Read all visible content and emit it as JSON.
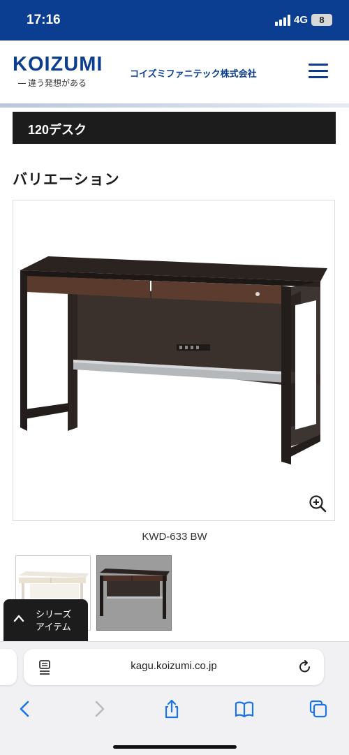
{
  "status_bar": {
    "time": "17:16",
    "network": "4G",
    "battery": "8"
  },
  "header": {
    "logo_text": "KOIZUMI",
    "logo_tagline": "違う発想がある",
    "company_name": "コイズミファニテック株式会社",
    "menu_icon": "hamburger-menu-icon"
  },
  "page": {
    "title": "120デスク",
    "section_heading": "バリエーション",
    "product_caption": "KWD-633 BW",
    "zoom_icon": "zoom-in-icon"
  },
  "thumbnails": [
    {
      "variant": "white desk",
      "selected": false
    },
    {
      "variant": "dark brown desk",
      "selected": true
    }
  ],
  "floating_button": {
    "line1": "シリーズ",
    "line2": "アイテム",
    "icon": "chevron-up-icon"
  },
  "browser": {
    "url": "kagu.koizumi.co.jp",
    "reader_icon": "reader-mode-icon",
    "reload_icon": "reload-icon",
    "toolbar_icons": [
      "back-icon",
      "forward-icon",
      "share-icon",
      "bookmarks-icon",
      "tabs-icon"
    ],
    "accent_color": "#1a73e8"
  },
  "colors": {
    "brand": "#0b3d91",
    "title_bar": "#1c1c1c",
    "status_bar": "#0b3d91"
  }
}
